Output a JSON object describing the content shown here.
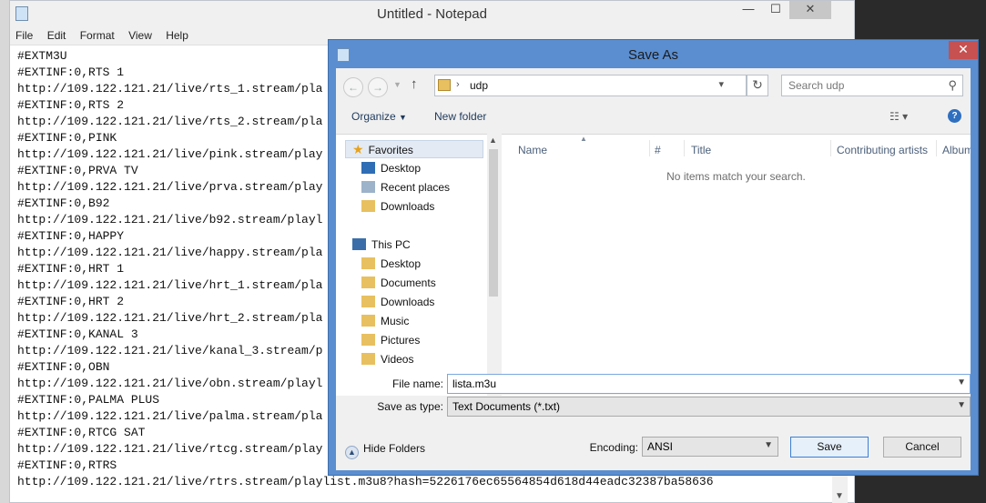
{
  "notepad": {
    "title": "Untitled - Notepad",
    "menu": [
      "File",
      "Edit",
      "Format",
      "View",
      "Help"
    ],
    "lines": [
      "#EXTM3U",
      "#EXTINF:0,RTS 1",
      "http://109.122.121.21/live/rts_1.stream/pla",
      "#EXTINF:0,RTS 2",
      "http://109.122.121.21/live/rts_2.stream/pla",
      "#EXTINF:0,PINK",
      "http://109.122.121.21/live/pink.stream/play",
      "#EXTINF:0,PRVA TV",
      "http://109.122.121.21/live/prva.stream/play",
      "#EXTINF:0,B92",
      "http://109.122.121.21/live/b92.stream/playl",
      "#EXTINF:0,HAPPY",
      "http://109.122.121.21/live/happy.stream/pla",
      "#EXTINF:0,HRT 1",
      "http://109.122.121.21/live/hrt_1.stream/pla",
      "#EXTINF:0,HRT 2",
      "http://109.122.121.21/live/hrt_2.stream/pla",
      "#EXTINF:0,KANAL 3",
      "http://109.122.121.21/live/kanal_3.stream/p",
      "#EXTINF:0,OBN",
      "http://109.122.121.21/live/obn.stream/playl",
      "#EXTINF:0,PALMA PLUS",
      "http://109.122.121.21/live/palma.stream/pla",
      "#EXTINF:0,RTCG SAT",
      "http://109.122.121.21/live/rtcg.stream/play",
      "#EXTINF:0,RTRS",
      "http://109.122.121.21/live/rtrs.stream/playlist.m3u8?hash=5226176ec65564854d618d44eadc32387ba58636"
    ]
  },
  "dialog": {
    "title": "Save As",
    "address": {
      "path": "udp"
    },
    "search": {
      "placeholder": "Search udp"
    },
    "toolbar": {
      "organize": "Organize",
      "new_folder": "New folder"
    },
    "nav": {
      "favorites_label": "Favorites",
      "favorites": [
        "Desktop",
        "Recent places",
        "Downloads"
      ],
      "thispc_label": "This PC",
      "thispc": [
        "Desktop",
        "Documents",
        "Downloads",
        "Music",
        "Pictures",
        "Videos"
      ]
    },
    "columns": [
      "Name",
      "#",
      "Title",
      "Contributing artists",
      "Album"
    ],
    "empty_message": "No items match your search.",
    "file_name_label": "File name:",
    "file_name_value": "lista.m3u",
    "save_type_label": "Save as type:",
    "save_type_value": "Text Documents (*.txt)",
    "hide_folders": "Hide Folders",
    "encoding_label": "Encoding:",
    "encoding_value": "ANSI",
    "save_button": "Save",
    "cancel_button": "Cancel"
  },
  "colors": {
    "dialog_frame": "#5a8ed0",
    "close_button": "#c75050",
    "selected_nav": "#e3eaf3"
  }
}
